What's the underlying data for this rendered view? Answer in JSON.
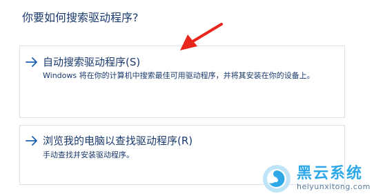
{
  "dialog": {
    "question": "你要如何搜索驱动程序?"
  },
  "options": [
    {
      "title": "自动搜索驱动程序(S)",
      "description": "Windows 将在你的计算机中搜索最佳可用驱动程序，并将其安装在你的设备上。"
    },
    {
      "title": "浏览我的电脑以查找驱动程序(R)",
      "description": "手动查找并安装驱动程序。"
    }
  ],
  "watermark": {
    "brand": "黑云系统",
    "url": "heiyunxitong.com"
  },
  "colors": {
    "text": "#1a3a6e",
    "arrow": "#1a5fb4",
    "pointer": "#e8261c",
    "watermark_brand": "#2ea8e6"
  }
}
